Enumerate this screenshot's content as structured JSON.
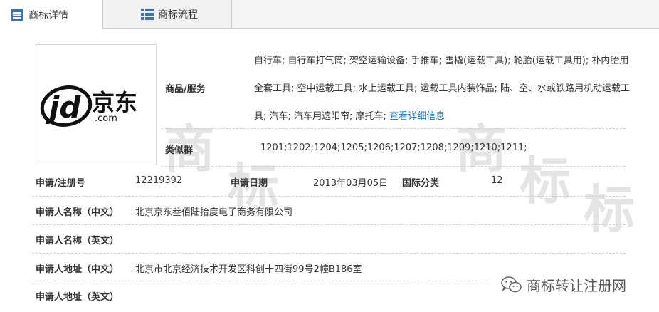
{
  "tabs": [
    {
      "label": "商标详情",
      "icon": "list-icon"
    },
    {
      "label": "商标流程",
      "icon": "grid-icon"
    }
  ],
  "logo": {
    "jd_text": "jd",
    "cn_text": "京东",
    "com_text": ".com"
  },
  "goods": {
    "label": "商品/服务",
    "text": "自行车; 自行车打气筒; 架空运输设备; 手推车; 雪橇(运载工具); 轮胎(运载工具用); 补内胎用全套工具; 空中运载工具; 水上运载工具; 运载工具内装饰品; 陆、空、水或铁路用机动运载工具; 汽车; 汽车用遮阳帘; 摩托车;",
    "link_text": "查看详细信息"
  },
  "similar_group": {
    "label": "类似群",
    "value": "1201;1202;1204;1205;1206;1207;1208;1209;1210;1211;"
  },
  "registration_no": {
    "label": "申请/注册号",
    "value": "12219392"
  },
  "apply_date": {
    "label": "申请日期",
    "value": "2013年03月05日"
  },
  "intl_class": {
    "label": "国际分类",
    "value": "12"
  },
  "applicant_cn": {
    "label": "申请人名称（中文）",
    "value": "北京京东叁佰陆拾度电子商务有限公司"
  },
  "applicant_en": {
    "label": "申请人名称（英文）",
    "value": ""
  },
  "address_cn": {
    "label": "申请人地址（中文）",
    "value": "北京市北京经济技术开发区科创十四街99号2幢B186室"
  },
  "address_en": {
    "label": "申请人地址（英文）",
    "value": ""
  },
  "watermark": {
    "text": "商标转让注册网"
  },
  "colors": {
    "link": "#1a73c9",
    "logo_red": "#d7000f",
    "tab_icon": "#3b6fb6"
  }
}
